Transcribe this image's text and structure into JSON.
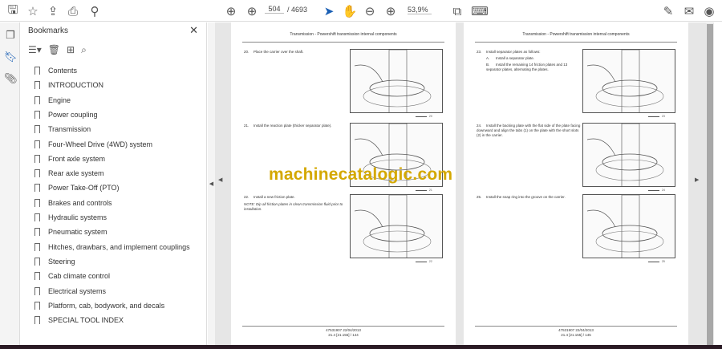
{
  "toolbar": {
    "page_current": "504",
    "page_total": "/ 4693",
    "zoom": "53,9%"
  },
  "bookmarks": {
    "title": "Bookmarks",
    "items": [
      "Contents",
      "INTRODUCTION",
      "Engine",
      "Power coupling",
      "Transmission",
      "Four-Wheel Drive (4WD) system",
      "Front axle system",
      "Rear axle system",
      "Power Take-Off (PTO)",
      "Brakes and controls",
      "Hydraulic systems",
      "Pneumatic system",
      "Hitches, drawbars, and implement couplings",
      "Steering",
      "Cab climate control",
      "Electrical systems",
      "Platform, cab, bodywork, and decals",
      "SPECIAL TOOL INDEX"
    ]
  },
  "pages": [
    {
      "header": "Transmission - Powershift transmission internal components",
      "steps": [
        {
          "n": "20.",
          "text": "Place the carrier over the shaft."
        },
        {
          "n": "21.",
          "text": "Install the reaction plate (thicker separator plate)."
        },
        {
          "n": "22.",
          "text": "Install a new friction plate.",
          "note": "NOTE: Dip all friction plates in clean transmission fluid prior to installation."
        }
      ],
      "footer1": "47531907 22/04/2013",
      "footer2": "21.4 [21.155] / 144"
    },
    {
      "header": "Transmission - Powershift transmission internal components",
      "steps": [
        {
          "n": "23.",
          "text": "Install separator plates as follows:",
          "sub": [
            {
              "l": "A.",
              "t": "Install a separator plate."
            },
            {
              "l": "B.",
              "t": "Install the remaining 14 friction plates and 13 separator plates, alternating the plates."
            }
          ]
        },
        {
          "n": "24.",
          "text": "Install the backing plate with the flat side of the plate facing downward and align the tabs (1) on the plate with the short slots (2) in the carrier."
        },
        {
          "n": "25.",
          "text": "Install the snap ring into the groove on the carrier."
        }
      ],
      "footer1": "47531907 22/04/2013",
      "footer2": "21.4 [21.155] / 145"
    }
  ],
  "watermark": "machinecatalogic.com"
}
